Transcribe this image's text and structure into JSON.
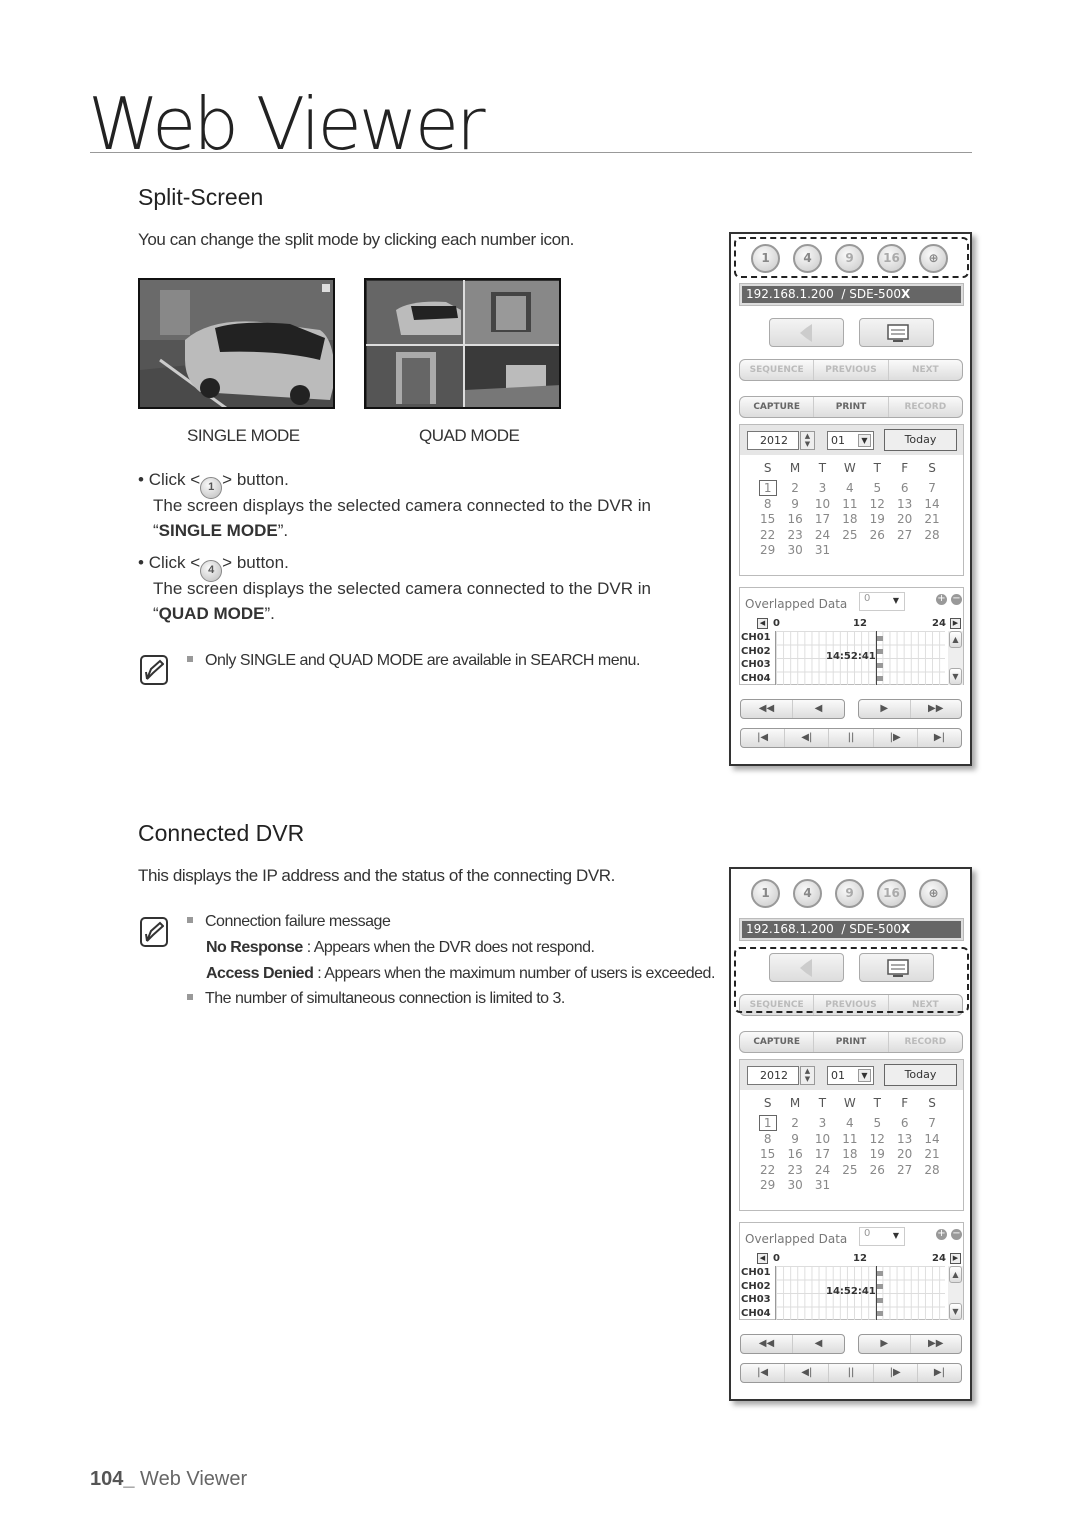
{
  "chapter": {
    "title": "Web Viewer"
  },
  "split_screen": {
    "title": "Split-Screen",
    "intro": "You can change the split mode by clicking each number icon.",
    "single_label": "SINGLE MODE",
    "quad_label": "QUAD MODE",
    "steps": [
      {
        "click_prefix": "Click <",
        "button": "1",
        "click_suffix": "> button.",
        "desc": "The screen displays the selected camera connected to the DVR in",
        "mode_open": "“",
        "mode": "SINGLE MODE",
        "mode_close": "”."
      },
      {
        "click_prefix": "Click <",
        "button": "4",
        "click_suffix": "> button.",
        "desc": "The screen displays the selected camera connected to the DVR in",
        "mode_open": "“",
        "mode": "QUAD MODE",
        "mode_close": "”."
      }
    ],
    "note": "Only SINGLE and QUAD MODE are available in SEARCH menu."
  },
  "connected_dvr": {
    "title": "Connected DVR",
    "intro": "This displays the IP address and the status of the connecting DVR.",
    "note_heading": "Connection failure message",
    "no_response_term": "No Response",
    "no_response_desc": " : Appears when the DVR does not respond.",
    "access_denied_term": "Access Denied",
    "access_denied_desc": " : Appears when the maximum number of users is exceeded.",
    "limit_note": "The number of simultaneous connection is limited to 3."
  },
  "panel": {
    "split_buttons": [
      "1",
      "4",
      "9",
      "16",
      "⊕"
    ],
    "ip": "192.168.1.200",
    "model_prefix": "  / SDE-500",
    "model_suffix": "X",
    "nav_buttons": [
      "SEQUENCE",
      "PREVIOUS",
      "NEXT"
    ],
    "action_buttons": [
      "CAPTURE",
      "PRINT",
      "RECORD"
    ],
    "year": "2012",
    "month": "01",
    "today_label": "Today",
    "weekdays": [
      "S",
      "M",
      "T",
      "W",
      "T",
      "F",
      "S"
    ],
    "days": [
      "1",
      "2",
      "3",
      "4",
      "5",
      "6",
      "7",
      "8",
      "9",
      "10",
      "11",
      "12",
      "13",
      "14",
      "15",
      "16",
      "17",
      "18",
      "19",
      "20",
      "21",
      "22",
      "23",
      "24",
      "25",
      "26",
      "27",
      "28",
      "29",
      "30",
      "31"
    ],
    "selected_day": "1",
    "overlapped_label": "Overlapped Data",
    "overlapped_value": "0",
    "timeline_ticks": [
      "0",
      "12",
      "24"
    ],
    "channels": [
      "CH01",
      "CH02",
      "CH03",
      "CH04"
    ],
    "current_time": "14:52:41",
    "playback_row1": [
      "◀◀",
      "◀",
      "▶",
      "▶▶"
    ],
    "playback_row2": [
      "|◀",
      "◀|",
      "||",
      "|▶",
      "▶|"
    ]
  },
  "footer": {
    "page_number": "104_",
    "section": " Web Viewer"
  }
}
